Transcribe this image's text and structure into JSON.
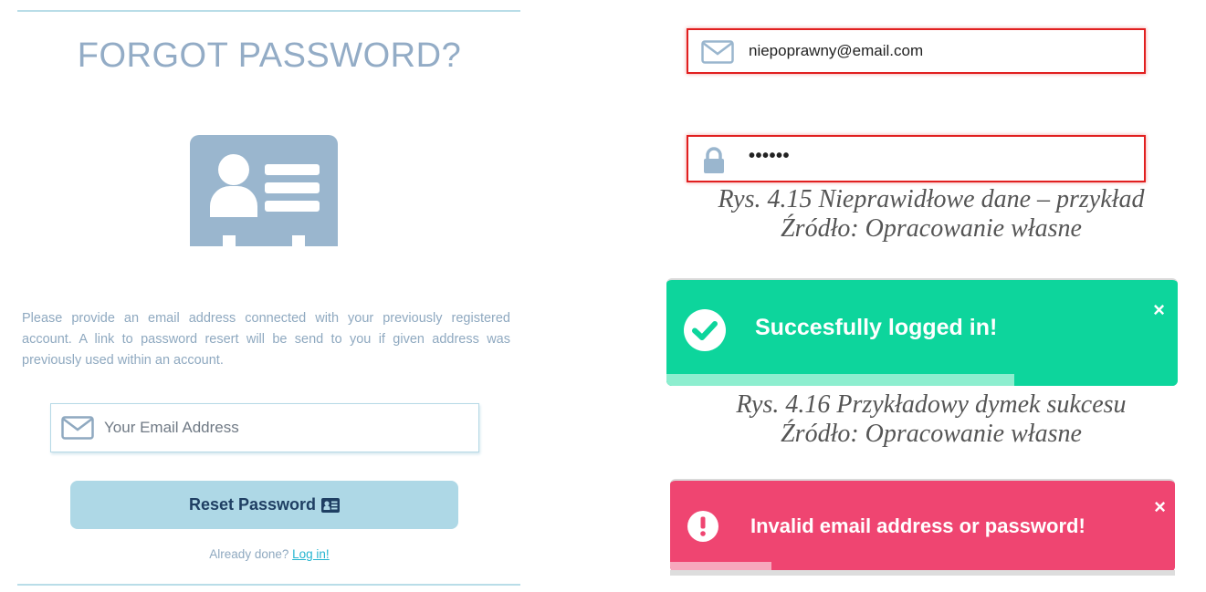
{
  "forgot_password": {
    "title": "FORGOT PASSWORD?",
    "icon": "id-card-icon",
    "description": "Please provide an email address connected with your previously registered account. A link to password resert will be send to you if given address was previously used within an account.",
    "email_placeholder": "Your Email Address",
    "reset_button": "Reset Password",
    "already_done": "Already done?",
    "login_link": "Log in!"
  },
  "invalid_example": {
    "email_value": "niepoprawny@email.com",
    "password_value": "••••••",
    "caption_line1": "Rys. 4.15 Nieprawidłowe dane – przykład",
    "caption_line2": "Źródło: Opracowanie własne"
  },
  "success_toast": {
    "message": "Succesfully logged in!",
    "close": "×",
    "progress": 0.68,
    "caption_line1": "Rys. 4.16 Przykładowy dymek sukcesu",
    "caption_line2": "Źródło: Opracowanie własne"
  },
  "error_toast": {
    "message": "Invalid email address or password!",
    "close": "×",
    "progress": 0.2
  },
  "colors": {
    "title": "#93acc6",
    "reset_button": "#aed8e6",
    "error_border": "#e11f1f",
    "success": "#0dd59c",
    "error": "#ef4571"
  }
}
